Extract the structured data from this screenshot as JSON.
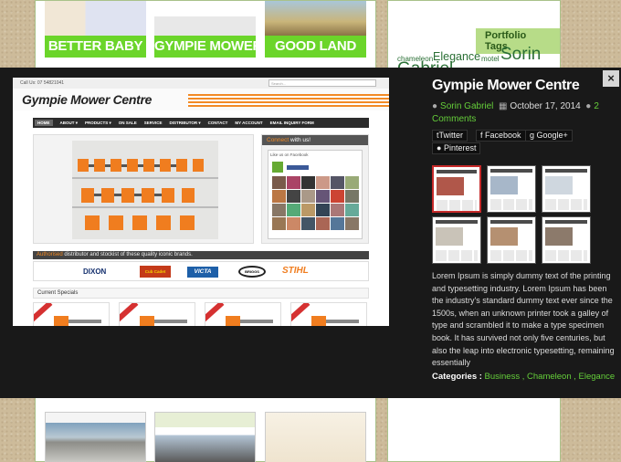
{
  "background": {
    "portfolio_thumbs": [
      "BETTER BABY",
      "GYMPIE MOWER",
      "GOOD LAND"
    ],
    "portfolio_tags": {
      "title": "Portfolio Tags",
      "tags": [
        "chameleon",
        "Elegance",
        "motel",
        "Sorin",
        "Gabriel"
      ]
    }
  },
  "lightbox": {
    "close_label": "×",
    "title": "Gympie Mower Centre",
    "author": "Sorin Gabriel",
    "date": "October 17, 2014",
    "comments_count": "2",
    "comments_label": "Comments",
    "share": [
      "Twitter",
      "Facebook",
      "Google+",
      "Pinterest"
    ],
    "description": "Lorem Ipsum is simply dummy text of the printing and typesetting industry. Lorem Ipsum has been the industry's standard dummy text ever since the 1500s, when an unknown printer took a galley of type and scrambled it to make a type specimen book. It has survived not only five centuries, but also the leap into electronic typesetting, remaining essentially",
    "categories_label": "Categories :",
    "categories": [
      "Business",
      "Chameleon",
      "Elegance"
    ],
    "gallery_count": 6,
    "selected_thumb": 1
  },
  "screenshot_site": {
    "call_us": "Call Us: 07 54821041",
    "search_placeholder": "Search...",
    "logo": "Gympie Mower Centre",
    "nav": [
      "HOME",
      "ABOUT ▾",
      "PRODUCTS ▾",
      "ON SALE",
      "SERVICE",
      "DISTRIBUTOR ▾",
      "CONTACT",
      "MY ACCOUNT",
      "EMAIL INQUIRY FORM"
    ],
    "connect_pre": "Connect",
    "connect_post": "with us!",
    "fb_text": "Like us on Facebook",
    "authorised_pre": "Authorised",
    "authorised_post": "distributor and stockist of these quality iconic brands.",
    "brands": [
      "DIXON",
      "Cub Cadet",
      "VICTA",
      "BRIGGS",
      "STIHL"
    ],
    "current_specials": "Current Specials",
    "on_sale": "ON SALE"
  },
  "colors": {
    "accent_green": "#65cf3a",
    "brand_orange": "#f28a25",
    "modal_bg": "#191919"
  }
}
